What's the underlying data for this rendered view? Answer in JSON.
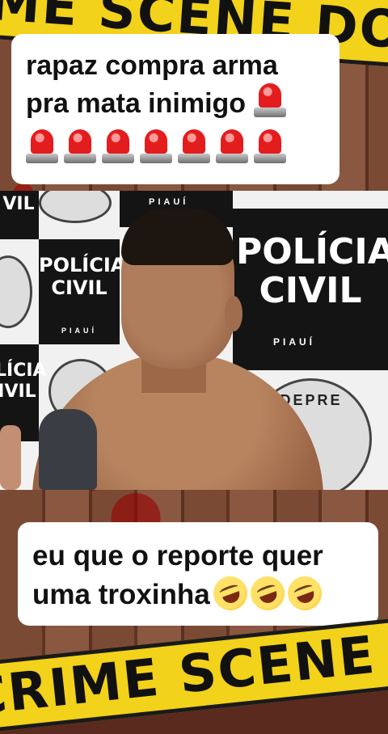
{
  "tape": {
    "top_text": "IME SCENE DO NOT CROS",
    "bottom_text": "CRIME SCENE DO NOT CROS"
  },
  "caption_top": {
    "line1": "rapaz compra arma",
    "line2": "pra mata inimigo",
    "siren_count_row": 7,
    "icon": "police-siren-emoji"
  },
  "video": {
    "backdrop_text_main_1": "POLÍCIA",
    "backdrop_text_main_2": "CIVIL",
    "backdrop_text_state": "PIAUÍ",
    "backdrop_text_left_1": "POLÍCIA",
    "backdrop_text_left_2": "CIVIL",
    "backdrop_text_top_left": "PIAUÍ",
    "backdrop_text_left_edge_1": "VIL",
    "backdrop_text_left_edge_2": "LÍCIA",
    "backdrop_text_left_edge_3": "IVIL",
    "seal_text": "DEPRE"
  },
  "caption_bottom": {
    "line1": "eu que o reporte quer",
    "line2": "uma troxinha",
    "icon": "rolling-on-floor-laughing-emoji",
    "emoji_count": 3
  }
}
